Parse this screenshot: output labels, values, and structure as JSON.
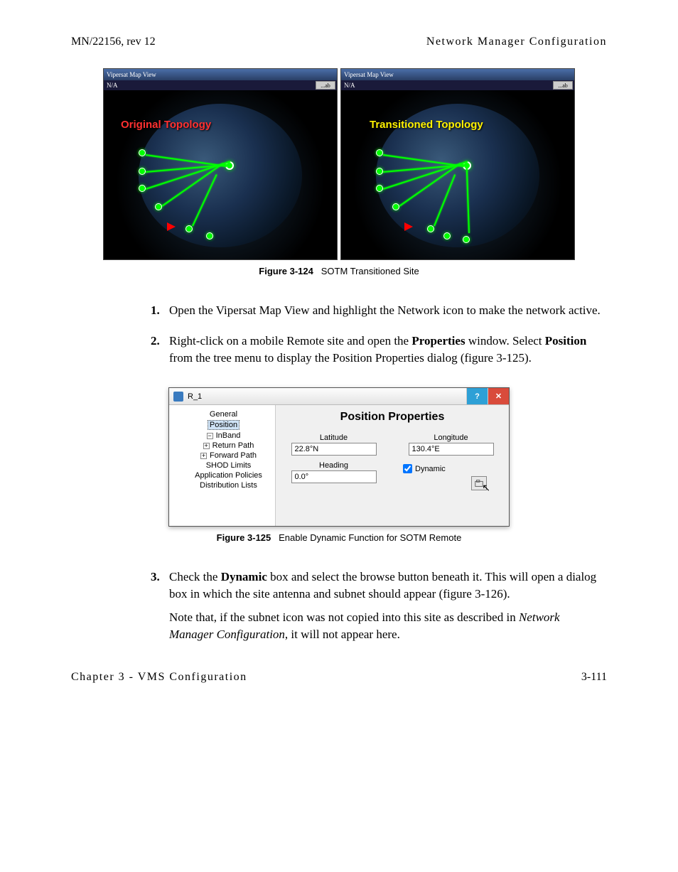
{
  "header": {
    "left": "MN/22156, rev 12",
    "right": "Network Manager Configuration"
  },
  "fig124": {
    "caption_label": "Figure 3-124",
    "caption_text": "SOTM Transitioned Site",
    "leftTitle": "Vipersat Map View",
    "rightTitle": "Vipersat Map View",
    "na": "N/A",
    "satBtn": "...ab",
    "overlayLeft": "Original Topology",
    "overlayRight": "Transitioned Topology"
  },
  "steps": {
    "s1": "Open the Vipersat Map View and highlight the Network icon to make the network active.",
    "s2a": "Right-click on a mobile Remote site and open the ",
    "s2b": "Properties",
    "s2c": " window. Select ",
    "s2d": "Position",
    "s2e": " from the tree menu to display the Position Properties dialog (figure 3-125).",
    "s3a": "Check the ",
    "s3b": "Dynamic",
    "s3c": " box and select the browse button beneath it. This will open a dialog box in which the site antenna and subnet should appear (figure 3-126).",
    "s3note_a": "Note that, if the subnet icon was not copied into this site as described in ",
    "s3note_b": "Network Manager Configuration",
    "s3note_c": ", it will not appear here."
  },
  "dialog": {
    "title": "R_1",
    "helpGlyph": "?",
    "closeGlyph": "✕",
    "tree": {
      "general": "General",
      "position": "Position",
      "inband": "InBand",
      "returnPath": "Return Path",
      "forwardPath": "Forward Path",
      "shod": "SHOD Limits",
      "appPolicies": "Application Policies",
      "distLists": "Distribution Lists"
    },
    "panel": {
      "heading": "Position Properties",
      "latLabel": "Latitude",
      "latValue": "22.8°N",
      "lonLabel": "Longitude",
      "lonValue": "130.4°E",
      "headingLabel": "Heading",
      "headingValue": "0.0°",
      "dynamicLabel": "Dynamic"
    }
  },
  "fig125": {
    "caption_label": "Figure 3-125",
    "caption_text": "Enable Dynamic Function for SOTM Remote"
  },
  "footer": {
    "left": "Chapter 3 - VMS Configuration",
    "right": "3-111"
  }
}
